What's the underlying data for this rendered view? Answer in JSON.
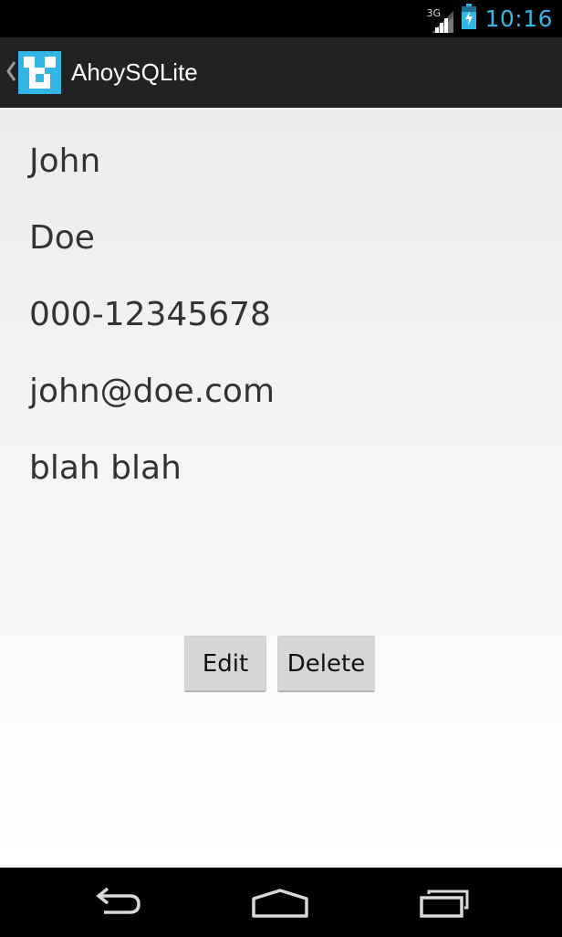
{
  "status_bar": {
    "network": "3G",
    "time": "10:16",
    "icons": [
      "signal-icon",
      "battery-charging-icon"
    ],
    "accent_color": "#33b5e5"
  },
  "action_bar": {
    "title": "AhoySQLite",
    "icons": [
      "up-caret-icon",
      "app-logo-icon"
    ],
    "icon_color": "#33b5e5"
  },
  "contact": {
    "first_name": "John",
    "last_name": "Doe",
    "phone": "000-12345678",
    "email": "john@doe.com",
    "notes": "blah blah"
  },
  "actions": {
    "edit_label": "Edit",
    "delete_label": "Delete"
  },
  "nav_bar": {
    "icons": [
      "back-icon",
      "home-icon",
      "recent-apps-icon"
    ]
  }
}
